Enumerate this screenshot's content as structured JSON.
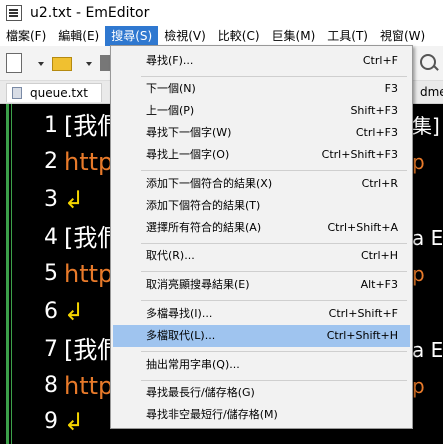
{
  "window": {
    "title": "u2.txt - EmEditor"
  },
  "menubar": [
    "檔案(F)",
    "編輯(E)",
    "搜尋(S)",
    "檢視(V)",
    "比較(C)",
    "巨集(M)",
    "工具(T)",
    "視窗(W)"
  ],
  "tabs": {
    "active": "queue.txt",
    "partial": "dme"
  },
  "editor": {
    "lines": [
      {
        "num": "1",
        "text": "[我們",
        "color": "white",
        "right": "集]"
      },
      {
        "num": "2",
        "text": "http",
        "color": "orange",
        "right": "p"
      },
      {
        "num": "3",
        "text": "↲",
        "color": "yellow",
        "right": ""
      },
      {
        "num": "4",
        "text": "[我們",
        "color": "white",
        "right": "a E"
      },
      {
        "num": "5",
        "text": "http",
        "color": "orange",
        "right": "p"
      },
      {
        "num": "6",
        "text": "↲",
        "color": "yellow",
        "right": ""
      },
      {
        "num": "7",
        "text": "[我們",
        "color": "white",
        "right": "a E"
      },
      {
        "num": "8",
        "text": "http",
        "color": "orange",
        "right": "p"
      },
      {
        "num": "9",
        "text": "↲",
        "color": "yellow",
        "right": ""
      }
    ]
  },
  "search_menu": {
    "items": [
      {
        "label": "尋找(F)...",
        "shortcut": "Ctrl+F"
      },
      {
        "label": "下一個(N)",
        "shortcut": "F3"
      },
      {
        "label": "上一個(P)",
        "shortcut": "Shift+F3"
      },
      {
        "label": "尋找下一個字(W)",
        "shortcut": "Ctrl+F3"
      },
      {
        "label": "尋找上一個字(O)",
        "shortcut": "Ctrl+Shift+F3"
      },
      {
        "label": "添加下一個符合的結果(X)",
        "shortcut": "Ctrl+R"
      },
      {
        "label": "添加下個符合的結果(T)",
        "shortcut": ""
      },
      {
        "label": "選擇所有符合的結果(A)",
        "shortcut": "Ctrl+Shift+A"
      },
      {
        "label": "取代(R)...",
        "shortcut": "Ctrl+H"
      },
      {
        "label": "取消亮顯搜尋結果(E)",
        "shortcut": "Alt+F3"
      },
      {
        "label": "多檔尋找(I)...",
        "shortcut": "Ctrl+Shift+F"
      },
      {
        "label": "多檔取代(L)...",
        "shortcut": "Ctrl+Shift+H"
      },
      {
        "label": "抽出常用字串(Q)...",
        "shortcut": ""
      },
      {
        "label": "尋找最長行/儲存格(G)",
        "shortcut": ""
      },
      {
        "label": "尋找非空最短行/儲存格(M)",
        "shortcut": ""
      }
    ],
    "highlighted": "多檔取代(L)..."
  }
}
